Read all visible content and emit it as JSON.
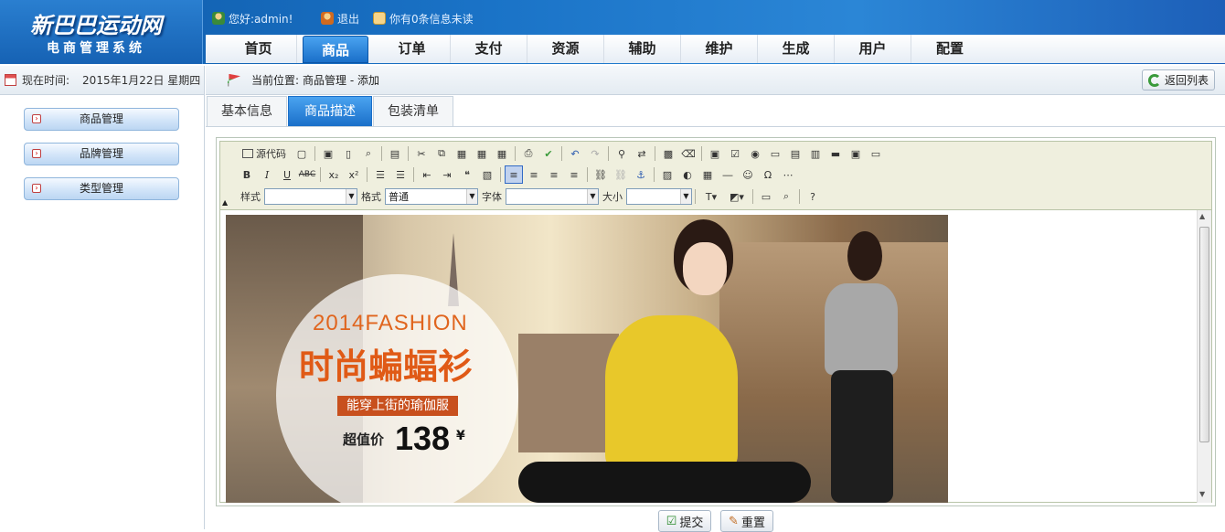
{
  "header": {
    "logo_title": "新巴巴运动网",
    "logo_subtitle": "电商管理系统",
    "greeting": "您好:admin!",
    "logout": "退出",
    "messages": "你有0条信息未读"
  },
  "nav": {
    "items": [
      "首页",
      "商品",
      "订单",
      "支付",
      "资源",
      "辅助",
      "维护",
      "生成",
      "用户",
      "配置"
    ],
    "active": "商品"
  },
  "sidebar": {
    "time_label": "现在时间:",
    "time_value": "2015年1月22日 星期四",
    "items": [
      "商品管理",
      "品牌管理",
      "类型管理"
    ]
  },
  "breadcrumb": {
    "label": "当前位置:",
    "path": "商品管理 - 添加",
    "back_button": "返回列表"
  },
  "tabs": {
    "items": [
      "基本信息",
      "商品描述",
      "包装清单"
    ],
    "active": "商品描述"
  },
  "editor": {
    "source_label": "源代码",
    "style_label": "样式",
    "format_label": "格式",
    "format_value": "普通",
    "font_label": "字体",
    "size_label": "大小",
    "banner": {
      "line1": "2014FASHION",
      "line2": "时尚蝙蝠衫",
      "line3": "能穿上街的瑜伽服",
      "price_label": "超值价",
      "price": "138",
      "currency": "¥"
    }
  },
  "actions": {
    "submit": "提交",
    "reset": "重置"
  },
  "colors": {
    "header_blue": "#1a6fc9",
    "accent_orange": "#e05a16",
    "tab_active": "#1a6fc9"
  }
}
